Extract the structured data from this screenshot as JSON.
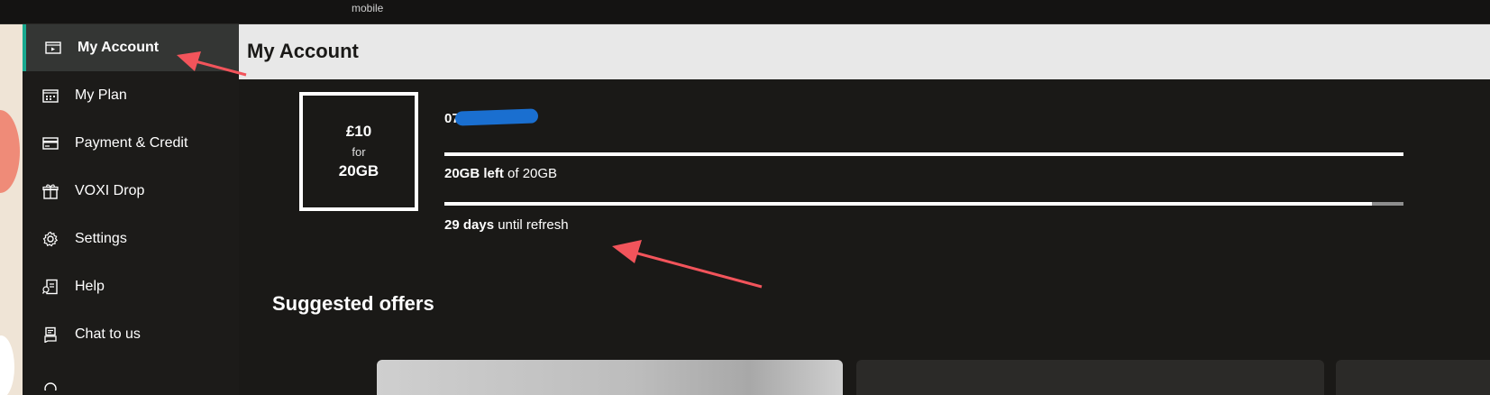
{
  "topbar": {
    "brand": "mobile"
  },
  "sidebar": {
    "items": [
      {
        "label": "My Account",
        "icon": "account-card-icon",
        "active": true
      },
      {
        "label": "My Plan",
        "icon": "calendar-grid-icon"
      },
      {
        "label": "Payment & Credit",
        "icon": "credit-card-icon"
      },
      {
        "label": "VOXI Drop",
        "icon": "gift-icon"
      },
      {
        "label": "Settings",
        "icon": "gear-icon"
      },
      {
        "label": "Help",
        "icon": "help-document-icon"
      },
      {
        "label": "Chat to us",
        "icon": "chat-icon"
      }
    ]
  },
  "header": {
    "title": "My Account"
  },
  "plan": {
    "price": "£10",
    "for_text": "for",
    "data": "20GB"
  },
  "account": {
    "phone": "07",
    "data_left_value": "20GB left",
    "data_left_suffix": " of 20GB",
    "data_used_fraction": 0,
    "data_left_bar_fraction": 1.0,
    "refresh_days": "29 days",
    "refresh_suffix": " until refresh",
    "refresh_bar_fraction": 0.967
  },
  "offers": {
    "title": "Suggested offers"
  },
  "colors": {
    "accent": "#18a98f",
    "annotation_arrow": "#f2545b",
    "redaction": "#1a6fd0",
    "background": "#1a1917",
    "header_band": "#e8e8e8"
  }
}
